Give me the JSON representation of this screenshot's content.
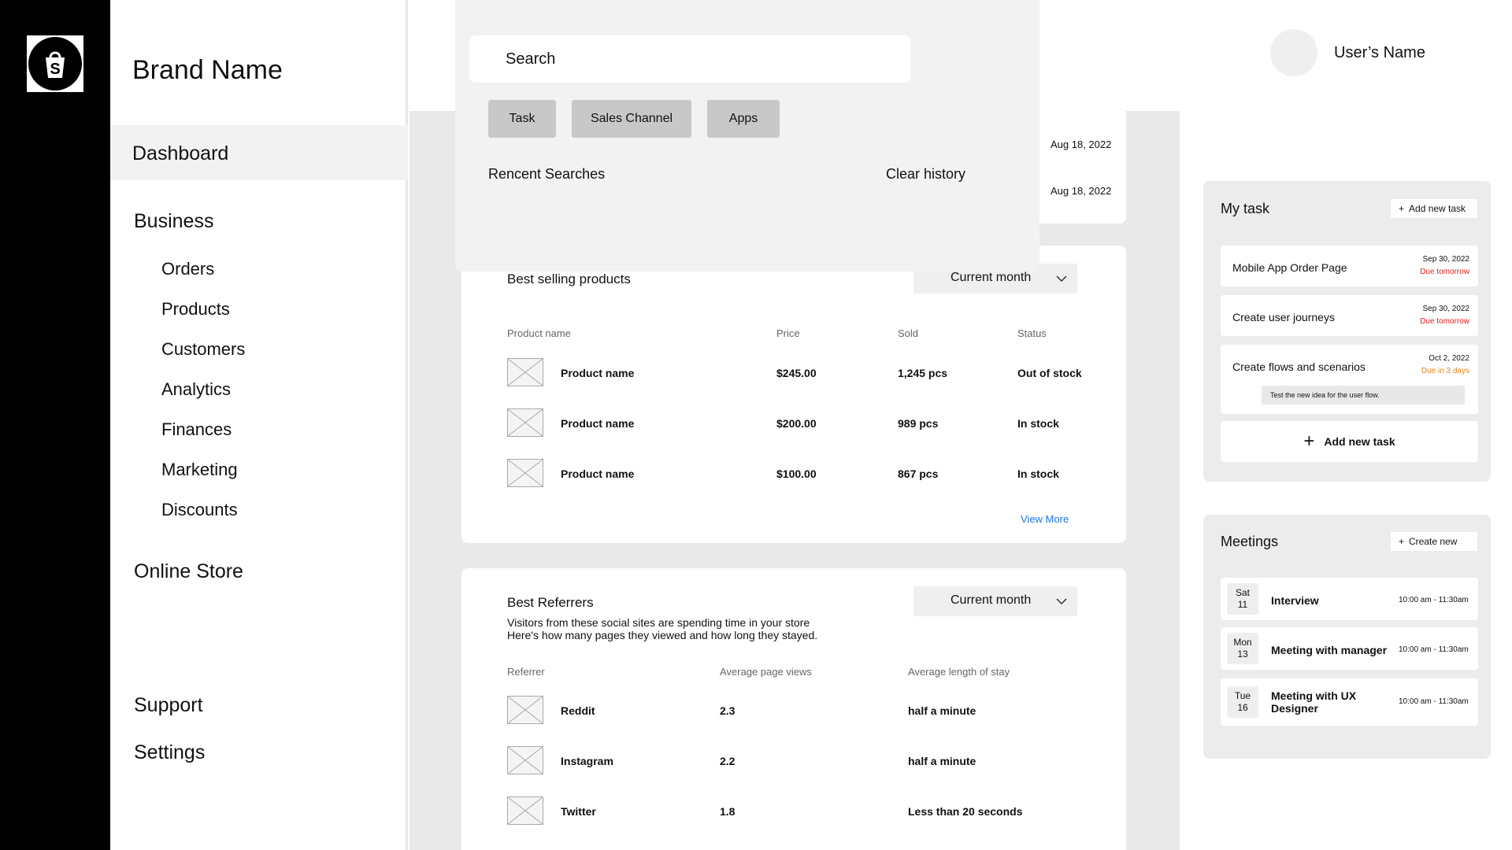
{
  "brand": {
    "name": "Brand Name",
    "logo_icon": "shopify-bag-icon"
  },
  "nav": {
    "dashboard": "Dashboard",
    "business": "Business",
    "items": [
      "Orders",
      "Products",
      "Customers",
      "Analytics",
      "Finances",
      "Marketing",
      "Discounts"
    ],
    "online_store": "Online Store",
    "support": "Support",
    "settings": "Settings"
  },
  "user": {
    "name": "User’s Name"
  },
  "search": {
    "placeholder": "Search",
    "chips": [
      "Task",
      "Sales Channel",
      "Apps"
    ],
    "recent_label": "Rencent Searches",
    "clear_label": "Clear history"
  },
  "top_card": {
    "dates": [
      "Aug 18, 2022",
      "Aug 18, 2022"
    ]
  },
  "best_selling": {
    "title": "Best selling products",
    "period": "Current month",
    "headers": [
      "Product name",
      "Price",
      "Sold",
      "Status"
    ],
    "rows": [
      {
        "name": "Product name",
        "price": "$245.00",
        "sold": "1,245 pcs",
        "status": "Out of stock"
      },
      {
        "name": "Product name",
        "price": "$200.00",
        "sold": "989 pcs",
        "status": "In stock"
      },
      {
        "name": "Product name",
        "price": "$100.00",
        "sold": "867 pcs",
        "status": "In stock"
      }
    ],
    "view_more": "View More"
  },
  "referrers": {
    "title": "Best Referrers",
    "period": "Current month",
    "desc1": "Visitors from these social sites are spending time in your store",
    "desc2": "Here's how many pages they viewed and how long they stayed.",
    "headers": [
      "Referrer",
      "Average page views",
      "Average length of stay"
    ],
    "rows": [
      {
        "name": "Reddit",
        "views": "2.3",
        "stay": "half a minute"
      },
      {
        "name": "Instagram",
        "views": "2.2",
        "stay": "half a minute"
      },
      {
        "name": "Twitter",
        "views": "1.8",
        "stay": "Less than 20 seconds"
      }
    ]
  },
  "tasks": {
    "title": "My task",
    "add_small": "Add new task",
    "items": [
      {
        "title": "Mobile App Order Page",
        "date": "Sep 30, 2022",
        "due": "Due tomorrow"
      },
      {
        "title": "Create user journeys",
        "date": "Sep 30, 2022",
        "due": "Due tomorrow"
      },
      {
        "title": "Create flows and scenarios",
        "date": "Oct 2, 2022",
        "due": "Due in 3 days",
        "note": "Test the new idea for the user flow."
      }
    ],
    "add_big": "Add new task"
  },
  "meetings": {
    "title": "Meetings",
    "create": "Create new",
    "items": [
      {
        "day": "Sat",
        "num": "11",
        "title": "Interview",
        "time": "10:00 am - 11:30am"
      },
      {
        "day": "Mon",
        "num": "13",
        "title": "Meeting with manager",
        "time": "10:00 am - 11:30am"
      },
      {
        "day": "Tue",
        "num": "16",
        "title": "Meeting with UX Designer",
        "time": "10:00 am - 11:30am"
      }
    ]
  },
  "colors": {
    "due_red": "#e02020",
    "due_orange": "#e8841a",
    "link_blue": "#1a73e8"
  }
}
